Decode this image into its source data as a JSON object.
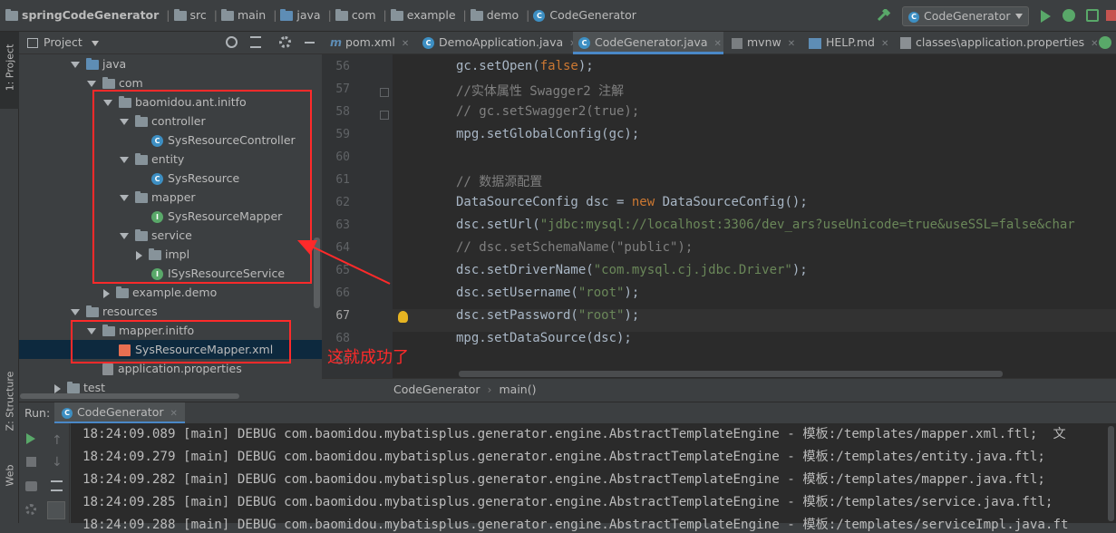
{
  "breadcrumb": {
    "project": "springCodeGenerator",
    "parts": [
      "src",
      "main",
      "java",
      "com",
      "example",
      "demo"
    ],
    "file": "CodeGenerator"
  },
  "run_config": {
    "label": "CodeGenerator"
  },
  "side_tabs": {
    "project": "1: Project",
    "structure": "Z: Structure",
    "web": "Web"
  },
  "project_panel": {
    "title": "Project"
  },
  "tree": [
    {
      "label": "java",
      "type": "folder-blue",
      "arrow": "down"
    },
    {
      "label": "com",
      "type": "folder",
      "arrow": "down"
    },
    {
      "label": "baomidou.ant.initfo",
      "type": "folder",
      "arrow": "down"
    },
    {
      "label": "controller",
      "type": "folder",
      "arrow": "down"
    },
    {
      "label": "SysResourceController",
      "type": "class"
    },
    {
      "label": "entity",
      "type": "folder",
      "arrow": "down"
    },
    {
      "label": "SysResource",
      "type": "class"
    },
    {
      "label": "mapper",
      "type": "folder",
      "arrow": "down"
    },
    {
      "label": "SysResourceMapper",
      "type": "interface"
    },
    {
      "label": "service",
      "type": "folder",
      "arrow": "down"
    },
    {
      "label": "impl",
      "type": "folder",
      "arrow": "right"
    },
    {
      "label": "ISysResourceService",
      "type": "interface"
    },
    {
      "label": "example.demo",
      "type": "folder",
      "arrow": "right"
    },
    {
      "label": "resources",
      "type": "folder",
      "arrow": "down"
    },
    {
      "label": "mapper.initfo",
      "type": "folder",
      "arrow": "down"
    },
    {
      "label": "SysResourceMapper.xml",
      "type": "xml"
    },
    {
      "label": "application.properties",
      "type": "props"
    },
    {
      "label": "test",
      "type": "folder",
      "arrow": "right"
    }
  ],
  "editor_tabs": [
    "pom.xml",
    "DemoApplication.java",
    "CodeGenerator.java",
    "mvnw",
    "HELP.md",
    "classes\\application.properties"
  ],
  "code": {
    "line_numbers": [
      "56",
      "57",
      "58",
      "59",
      "60",
      "61",
      "62",
      "63",
      "64",
      "65",
      "66",
      "67",
      "68",
      "69"
    ],
    "lines": [
      [
        {
          "t": "gc.setOpen(",
          "c": ""
        },
        {
          "t": "false",
          "c": "kw"
        },
        {
          "t": ");",
          "c": ""
        }
      ],
      [
        {
          "t": "//实体属性 Swagger2 注解",
          "c": "cm"
        }
      ],
      [
        {
          "t": "// gc.setSwagger2(true);",
          "c": "cm"
        }
      ],
      [
        {
          "t": "mpg.setGlobalConfig(gc);",
          "c": ""
        }
      ],
      [],
      [
        {
          "t": "// 数据源配置",
          "c": "cm"
        }
      ],
      [
        {
          "t": "DataSourceConfig dsc = ",
          "c": ""
        },
        {
          "t": "new",
          "c": "kw"
        },
        {
          "t": " DataSourceConfig();",
          "c": ""
        }
      ],
      [
        {
          "t": "dsc.setUrl(",
          "c": ""
        },
        {
          "t": "\"jdbc:mysql://localhost:3306/dev_ars?useUnicode=true&useSSL=false&char",
          "c": "str"
        }
      ],
      [
        {
          "t": "// dsc.setSchemaName(\"public\");",
          "c": "cm"
        }
      ],
      [
        {
          "t": "dsc.setDriverName(",
          "c": ""
        },
        {
          "t": "\"com.mysql.cj.jdbc.Driver\"",
          "c": "str"
        },
        {
          "t": ");",
          "c": ""
        }
      ],
      [
        {
          "t": "dsc.setUsername(",
          "c": ""
        },
        {
          "t": "\"root\"",
          "c": "str"
        },
        {
          "t": ");",
          "c": ""
        }
      ],
      [
        {
          "t": "dsc.setPassword(",
          "c": ""
        },
        {
          "t": "\"root\"",
          "c": "str"
        },
        {
          "t": ");",
          "c": ""
        }
      ],
      [
        {
          "t": "mpg.setDataSource(dsc);",
          "c": ""
        }
      ],
      []
    ]
  },
  "editor_breadcrumb": {
    "class": "CodeGenerator",
    "method": "main()"
  },
  "annotation": {
    "text": "这就成功了"
  },
  "run_panel": {
    "label": "Run:",
    "tab": "CodeGenerator",
    "logs": [
      "18:24:09.089 [main] DEBUG com.baomidou.mybatisplus.generator.engine.AbstractTemplateEngine - 模板:/templates/mapper.xml.ftl;  文",
      "18:24:09.279 [main] DEBUG com.baomidou.mybatisplus.generator.engine.AbstractTemplateEngine - 模板:/templates/entity.java.ftl;",
      "18:24:09.282 [main] DEBUG com.baomidou.mybatisplus.generator.engine.AbstractTemplateEngine - 模板:/templates/mapper.java.ftl;",
      "18:24:09.285 [main] DEBUG com.baomidou.mybatisplus.generator.engine.AbstractTemplateEngine - 模板:/templates/service.java.ftl;",
      "18:24:09.288 [main] DEBUG com.baomidou.mybatisplus.generator.engine.AbstractTemplateEngine - 模板:/templates/serviceImpl.java.ft"
    ]
  },
  "colors": {
    "bg": "#2b2b2b",
    "panel": "#3c3f41",
    "selection": "#0d293e",
    "annotation": "#ff2a2a"
  }
}
